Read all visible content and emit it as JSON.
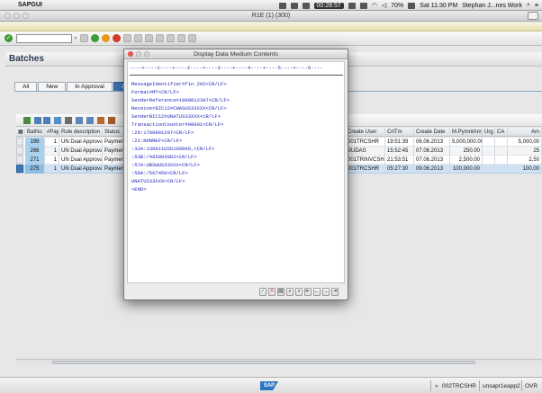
{
  "menubar": {
    "app_name": "SAPGUI",
    "clock": "00:28:57",
    "battery": "70%",
    "datetime": "Sat 11:30 PM",
    "user": "Stephan J...nes Work"
  },
  "window": {
    "title": "R1E (1) (300)"
  },
  "page": {
    "title": "Batches"
  },
  "tabs": [
    {
      "label": "All"
    },
    {
      "label": "New"
    },
    {
      "label": "In Approval"
    },
    {
      "label": "App"
    }
  ],
  "grid": {
    "columns": [
      "BatNo",
      "#Pay",
      "Rule description",
      "Status",
      "Create User",
      "CrtTm",
      "Create Date",
      "M.PymntAmt",
      "Urg",
      "CA",
      "Am"
    ],
    "rows": [
      {
        "batno": "199",
        "pay": "1",
        "rule": "UN Dual Approval",
        "status": "Payment",
        "user": "001TRCSHR",
        "time": "19:51:39",
        "date": "06.06.2013",
        "amt": "5,000,000.00",
        "am": "5,000,00"
      },
      {
        "batno": "266",
        "pay": "1",
        "rule": "UN Dual Approval",
        "status": "Payment",
        "user": "SUDAS",
        "time": "15:52:45",
        "date": "07.06.2013",
        "amt": "250.00",
        "am": "25"
      },
      {
        "batno": "271",
        "pay": "1",
        "rule": "UN Dual Approval",
        "status": "Payment",
        "user": "001TRINVCSHR",
        "time": "21:53:51",
        "date": "07.06.2013",
        "amt": "2,500.00",
        "am": "2,50"
      },
      {
        "batno": "275",
        "pay": "1",
        "rule": "UN Dual Approval",
        "status": "Payment",
        "user": "001TRCSHR",
        "time": "05:27:30",
        "date": "09.06.2013",
        "amt": "100,000.00",
        "am": "100,00"
      }
    ]
  },
  "dialog": {
    "title": "Display Data Medium Contents",
    "ruler": "----+----1----+----2----+----3----+----4----+----5----+----6----",
    "lines": [
      "MessageIdentifier#fin.202<CR/LF>",
      "Format#MT<CR/LF>",
      "SenderReference#1000012307<CR/LF>",
      "ReceiverBIC12#CHASUS33XXX<CR/LF>",
      "SenderBIC12#UNATUS33XXX<CR/LF>",
      "TransactionCounter#00001<CR/LF>",
      ":20:1700001207<CR/LF>",
      ":21:NONREF<CR/LF>",
      ":32A:130611USD100000,<CR/LF>",
      ":53B:/485003082<CR/LF>",
      ":57A:UBSWUS33XXX<CR/LF>",
      ":58A:/567456<CR/LF>",
      "UNATUS33XXX<CR/LF>",
      "<END>"
    ]
  },
  "status": {
    "arrows": "»",
    "user": "002TRCSHR",
    "server": "unsapr1eapp2",
    "mode": "OVR"
  }
}
